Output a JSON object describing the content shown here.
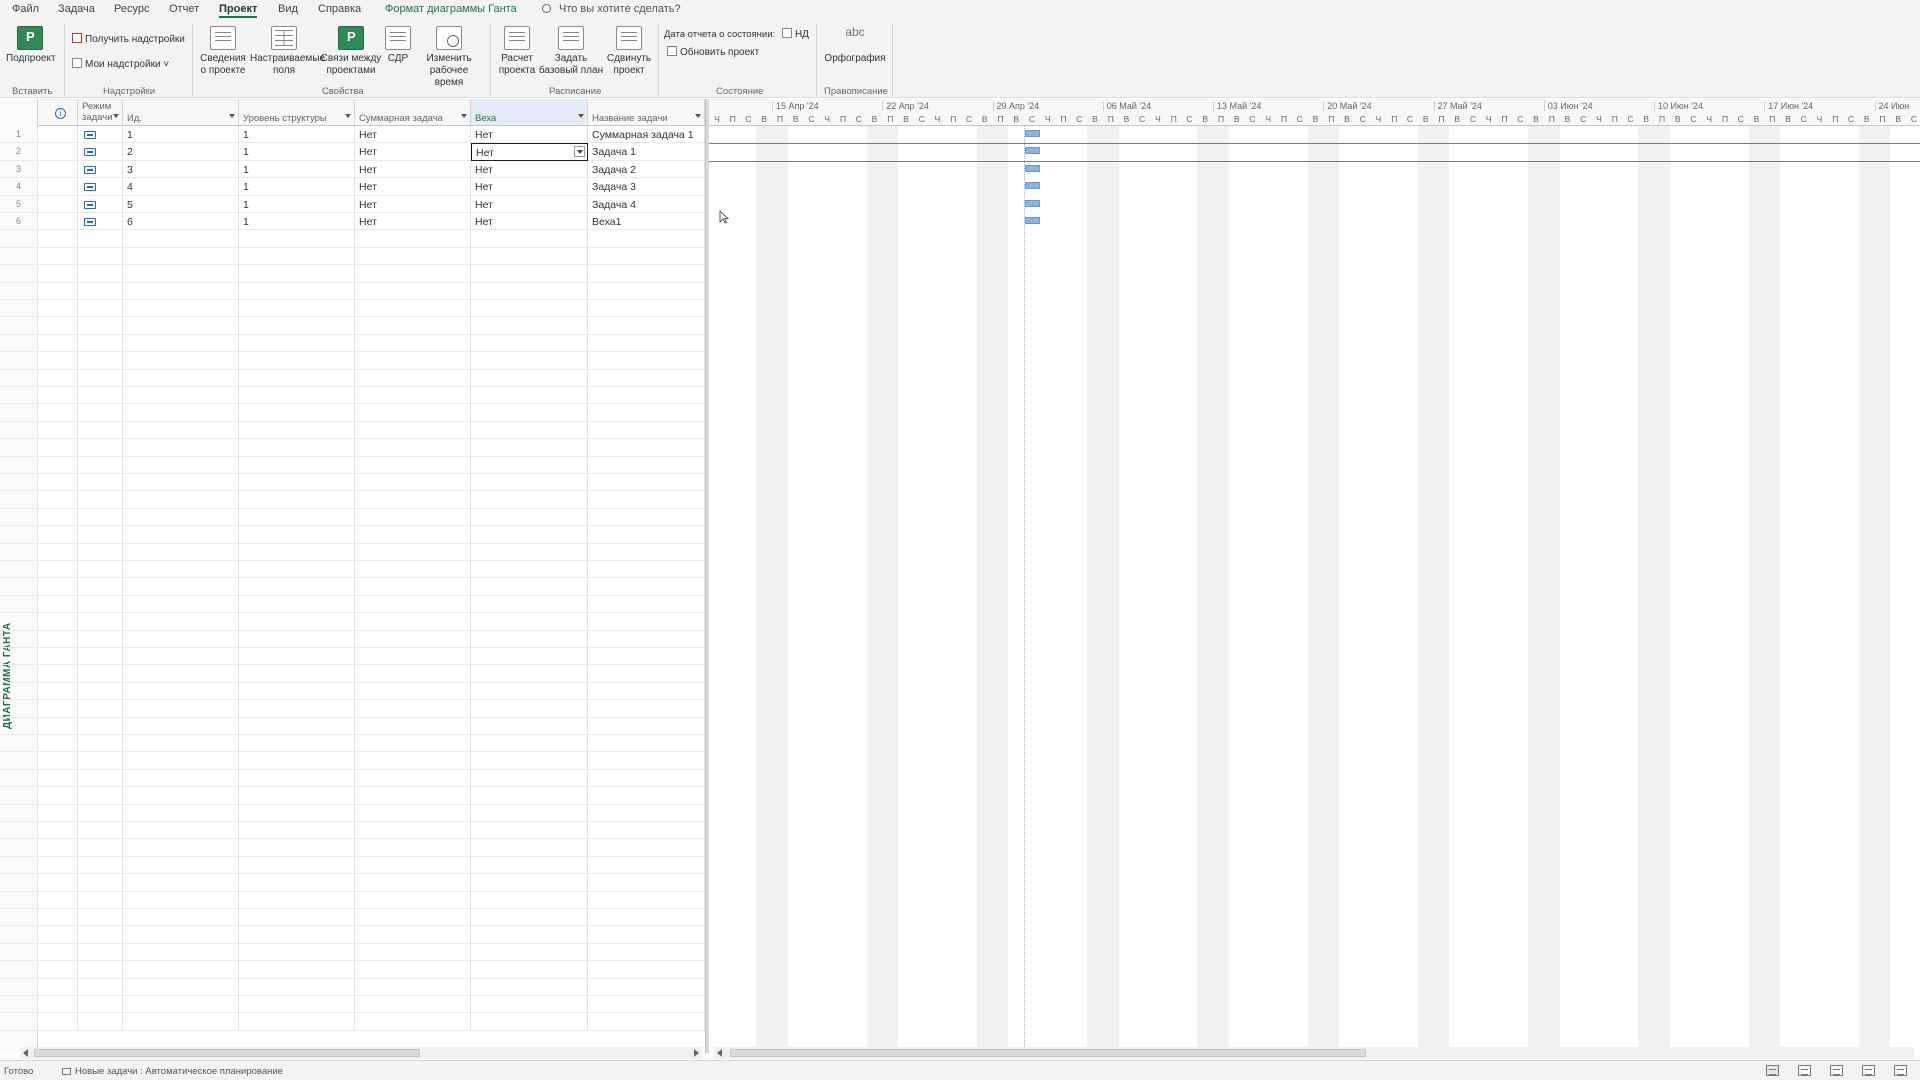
{
  "menu": {
    "tabs": [
      {
        "label": "Файл"
      },
      {
        "label": "Задача"
      },
      {
        "label": "Ресурс"
      },
      {
        "label": "Отчет"
      },
      {
        "label": "Проект",
        "active": true
      },
      {
        "label": "Вид"
      },
      {
        "label": "Справка"
      },
      {
        "label": "Формат диаграммы Ганта",
        "contextual": true
      }
    ],
    "search_placeholder": "Что вы хотите сделать?"
  },
  "ribbon": {
    "insert": {
      "subproject": "Подпроект",
      "group": "Вставить"
    },
    "addins": {
      "get": "Получить надстройки",
      "mine": "Мои надстройки",
      "group": "Надстройки"
    },
    "properties": {
      "project_info": "Сведения о проекте",
      "custom_fields": "Настраиваемые поля",
      "links": "Связи между проектами",
      "wbs": "СДР",
      "working_time": "Изменить рабочее время",
      "group": "Свойства"
    },
    "schedule": {
      "calculate": "Расчет проекта",
      "baseline": "Задать базовый план",
      "move": "Сдвинуть проект",
      "group": "Расписание"
    },
    "status": {
      "status_date_label": "Дата отчета о состоянии:",
      "status_date_value": "НД",
      "update": "Обновить проект",
      "group": "Состояние"
    },
    "proofing": {
      "spelling": "Орфография",
      "abc": "abc",
      "group": "Правописание"
    }
  },
  "view_label": "ДИАГРАММА ГАНТА",
  "table": {
    "columns": [
      "Режим задачи",
      "Ид.",
      "Уровень структуры",
      "Суммарная задача",
      "Веха",
      "Название задачи"
    ],
    "info_symbol": "i",
    "rows": [
      {
        "num": "1",
        "id": "1",
        "level": "1",
        "summary": "Нет",
        "milestone": "Нет",
        "name": "Суммарная задача 1"
      },
      {
        "num": "2",
        "id": "2",
        "level": "1",
        "summary": "Нет",
        "milestone": "Нет",
        "name": "Задача 1"
      },
      {
        "num": "3",
        "id": "3",
        "level": "1",
        "summary": "Нет",
        "milestone": "Нет",
        "name": "Задача 2"
      },
      {
        "num": "4",
        "id": "4",
        "level": "1",
        "summary": "Нет",
        "milestone": "Нет",
        "name": "Задача 3"
      },
      {
        "num": "5",
        "id": "5",
        "level": "1",
        "summary": "Нет",
        "milestone": "Нет",
        "name": "Задача 4"
      },
      {
        "num": "6",
        "id": "6",
        "level": "1",
        "summary": "Нет",
        "milestone": "Нет",
        "name": "Веха1"
      }
    ],
    "selected_row": 2,
    "empty_rows": 46
  },
  "gantt": {
    "weeks": [
      "15 Апр '24",
      "22 Апр '24",
      "29 Апр '24",
      "06 Май '24",
      "13 Май '24",
      "20 Май '24",
      "27 Май '24",
      "03 Июн '24",
      "10 Июн '24",
      "17 Июн '24",
      "24 Июн"
    ],
    "day_letters": [
      "Ч",
      "П",
      "С",
      "В",
      "П",
      "В",
      "С",
      "Ч",
      "П",
      "С",
      "В",
      "П",
      "В",
      "С",
      "Ч",
      "П",
      "С",
      "В",
      "П",
      "В",
      "С",
      "Ч",
      "П",
      "С",
      "В",
      "П",
      "В",
      "С",
      "Ч",
      "П",
      "С",
      "В",
      "П",
      "В",
      "С",
      "Ч",
      "П",
      "С",
      "В",
      "П",
      "В",
      "С",
      "Ч",
      "П",
      "С",
      "В",
      "П",
      "В",
      "С",
      "Ч",
      "П",
      "С",
      "В",
      "П",
      "В",
      "С",
      "Ч",
      "П",
      "С",
      "В",
      "П",
      "В",
      "С",
      "Ч",
      "П",
      "С",
      "В",
      "П",
      "В",
      "С",
      "Ч",
      "П",
      "С",
      "В",
      "П",
      "В",
      "С"
    ],
    "bar_color": "#8cb3dd"
  },
  "status": {
    "ready": "Готово",
    "new_tasks": "Новые задачи : Автоматическое планирование"
  },
  "colors": {
    "accent": "#217346",
    "ribbon_bg": "#f3f3f3",
    "selection": "#e4ecf7"
  }
}
